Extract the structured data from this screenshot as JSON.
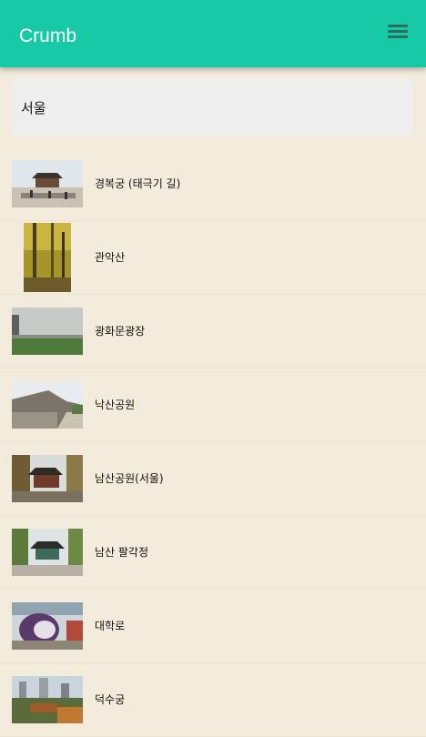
{
  "app": {
    "title": "Crumb"
  },
  "header": {
    "menu_icon": "hamburger-menu-icon"
  },
  "search": {
    "value": "서울"
  },
  "places": [
    {
      "name": "경복궁 (태극기 길)"
    },
    {
      "name": "관악산"
    },
    {
      "name": "광화문광장"
    },
    {
      "name": "낙산공원"
    },
    {
      "name": "남산공원(서울)"
    },
    {
      "name": "남산 팔각정"
    },
    {
      "name": "대학로"
    },
    {
      "name": "덕수궁"
    }
  ],
  "colors": {
    "appbar": "#17c9a4",
    "background": "#f3ebdc",
    "search_bg": "#eeeeee"
  }
}
